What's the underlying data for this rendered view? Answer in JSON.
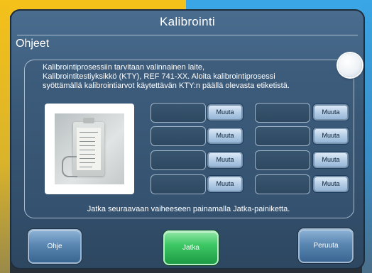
{
  "window": {
    "title": "Kalibrointi"
  },
  "section": {
    "label": "Ohjeet"
  },
  "instructions": {
    "line1": "Kalibrointiprosessiin tarvitaan valinnainen laite,",
    "line2": "Kalibrointitestiyksikkö (KTY),  REF 741-XX. Aloita kalibrointiprosessi",
    "line3": "syöttämällä kalibrointiarvot käytettävän KTY:n päällä olevasta etiketistä."
  },
  "device_label": {
    "header": "CTU SLN: 7401",
    "values": [
      "10.00",
      "20.00",
      "40.00",
      "60.00",
      "0.00",
      "-0.07",
      "-0.80",
      "0.00"
    ],
    "ref": "741-98"
  },
  "slots": {
    "button_label": "Muuta",
    "left": [
      {
        "value": "",
        "button": "Muuta"
      },
      {
        "value": "",
        "button": "Muuta"
      },
      {
        "value": "",
        "button": "Muuta"
      },
      {
        "value": "",
        "button": "Muuta"
      }
    ],
    "right": [
      {
        "value": "",
        "button": "Muuta"
      },
      {
        "value": "",
        "button": "Muuta"
      },
      {
        "value": "",
        "button": "Muuta"
      },
      {
        "value": "",
        "button": "Muuta"
      }
    ]
  },
  "hint": "Jatka seuraavaan vaiheeseen painamalla Jatka-painiketta.",
  "footer": {
    "help": "Ohje",
    "continue": "Jatka",
    "cancel": "Peruuta"
  },
  "colors": {
    "accent_yellow": "#f4c11a",
    "accent_blue": "#3aa6e6",
    "continue_green": "#3ec865"
  }
}
